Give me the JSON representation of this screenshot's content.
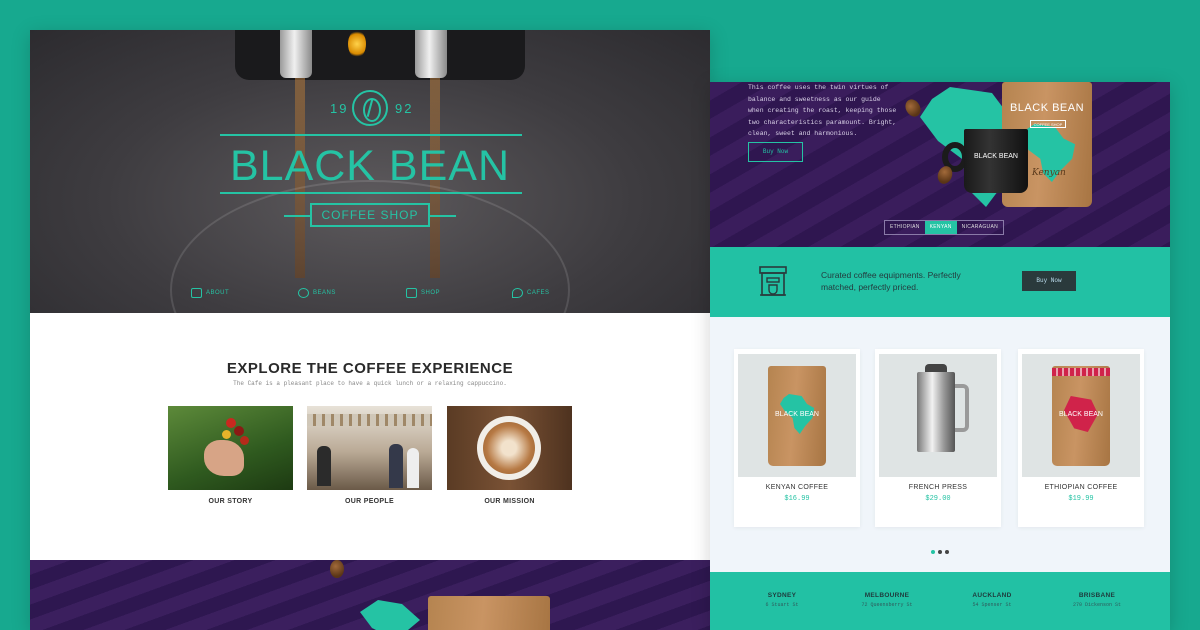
{
  "left": {
    "hero": {
      "year_left": "19",
      "year_right": "92",
      "brand": "BLACK BEAN",
      "tagline": "COFFEE SHOP",
      "nav": [
        {
          "label": "ABOUT",
          "icon": "camera-icon"
        },
        {
          "label": "BEANS",
          "icon": "bean-icon"
        },
        {
          "label": "SHOP",
          "icon": "bag-icon"
        },
        {
          "label": "CAFES",
          "icon": "map-pin-icon"
        }
      ]
    },
    "explore": {
      "title": "EXPLORE THE COFFEE EXPERIENCE",
      "subtitle": "The Cafe is a pleasant place to have a quick lunch or a relaxing cappuccino.",
      "cards": [
        {
          "label": "OUR STORY"
        },
        {
          "label": "OUR PEOPLE"
        },
        {
          "label": "OUR MISSION"
        }
      ]
    }
  },
  "right": {
    "promo": {
      "text": "This coffee uses the twin virtues of\nbalance and sweetness as our guide\nwhen creating the roast, keeping those\ntwo characteristics paramount. Bright,\nclean, sweet and harmonious.",
      "button": "Buy Now",
      "bag_brand": "BLACK BEAN",
      "bag_sub": "COFFEE SHOP",
      "bag_flavor": "Kenyan",
      "mug_brand": "BLACK BEAN",
      "tabs": [
        "ETHIOPIAN",
        "KENYAN",
        "NICARAGUAN"
      ],
      "active_tab": "KENYAN"
    },
    "equipment": {
      "text": "Curated coffee equipments. Perfectly matched, perfectly priced.",
      "button": "Buy Now"
    },
    "products": [
      {
        "name": "KENYAN COFFEE",
        "price": "$16.99",
        "bag_brand": "BLACK BEAN"
      },
      {
        "name": "FRENCH PRESS",
        "price": "$29.00"
      },
      {
        "name": "ETHIOPIAN COFFEE",
        "price": "$19.99",
        "bag_brand": "BLACK BEAN"
      }
    ],
    "locations": [
      {
        "city": "SYDNEY",
        "address": "6 Stuart St"
      },
      {
        "city": "MELBOURNE",
        "address": "72 Queensberry St"
      },
      {
        "city": "AUCKLAND",
        "address": "54 Spenser St"
      },
      {
        "city": "BRISBANE",
        "address": "270 Dickenson St"
      }
    ]
  },
  "colors": {
    "background": "#17a98f",
    "accent": "#25c3a4",
    "purple": "#3a1d5c",
    "dark": "#2a3a3c"
  }
}
